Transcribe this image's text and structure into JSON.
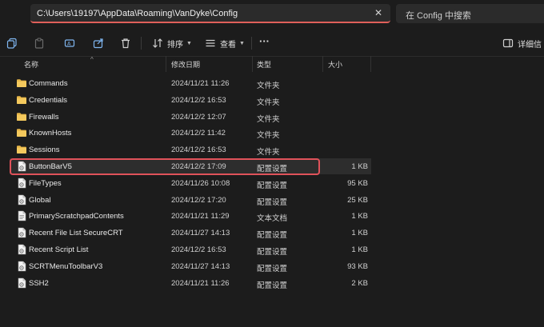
{
  "address_bar": {
    "path": "C:\\Users\\19197\\AppData\\Roaming\\VanDyke\\Config",
    "clear_icon": "close-icon"
  },
  "search": {
    "placeholder": "在 Config 中搜索"
  },
  "toolbar": {
    "sort_label": "排序",
    "view_label": "查看",
    "more_label": "···",
    "details_label": "详细信"
  },
  "columns": {
    "name": "名称",
    "modified": "修改日期",
    "type": "类型",
    "size": "大小"
  },
  "files": [
    {
      "name": "Commands",
      "modified": "2024/11/21 11:26",
      "type": "文件夹",
      "size": "",
      "icon": "folder-icon"
    },
    {
      "name": "Credentials",
      "modified": "2024/12/2 16:53",
      "type": "文件夹",
      "size": "",
      "icon": "folder-icon"
    },
    {
      "name": "Firewalls",
      "modified": "2024/12/2 12:07",
      "type": "文件夹",
      "size": "",
      "icon": "folder-icon"
    },
    {
      "name": "KnownHosts",
      "modified": "2024/12/2 11:42",
      "type": "文件夹",
      "size": "",
      "icon": "folder-icon"
    },
    {
      "name": "Sessions",
      "modified": "2024/12/2 16:53",
      "type": "文件夹",
      "size": "",
      "icon": "folder-icon"
    },
    {
      "name": "ButtonBarV5",
      "modified": "2024/12/2 17:09",
      "type": "配置设置",
      "size": "1 KB",
      "icon": "config-file-icon"
    },
    {
      "name": "FileTypes",
      "modified": "2024/11/26 10:08",
      "type": "配置设置",
      "size": "95 KB",
      "icon": "config-file-icon"
    },
    {
      "name": "Global",
      "modified": "2024/12/2 17:20",
      "type": "配置设置",
      "size": "25 KB",
      "icon": "config-file-icon"
    },
    {
      "name": "PrimaryScratchpadContents",
      "modified": "2024/11/21 11:29",
      "type": "文本文档",
      "size": "1 KB",
      "icon": "text-file-icon"
    },
    {
      "name": "Recent File List SecureCRT",
      "modified": "2024/11/27 14:13",
      "type": "配置设置",
      "size": "1 KB",
      "icon": "config-file-icon"
    },
    {
      "name": "Recent Script List",
      "modified": "2024/12/2 16:53",
      "type": "配置设置",
      "size": "1 KB",
      "icon": "config-file-icon"
    },
    {
      "name": "SCRTMenuToolbarV3",
      "modified": "2024/11/27 14:13",
      "type": "配置设置",
      "size": "93 KB",
      "icon": "config-file-icon"
    },
    {
      "name": "SSH2",
      "modified": "2024/11/21 11:26",
      "type": "配置设置",
      "size": "2 KB",
      "icon": "config-file-icon"
    }
  ],
  "colors": {
    "accent_highlight": "#e0525a",
    "folder": "#e8b84a",
    "background": "#1c1c1c"
  }
}
